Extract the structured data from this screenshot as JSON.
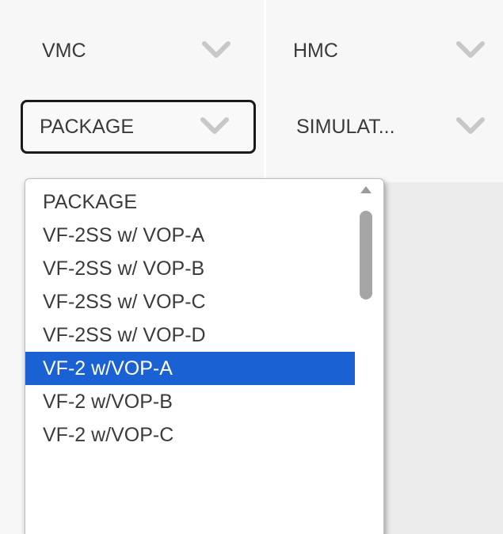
{
  "filters": {
    "vmc": {
      "label": "VMC",
      "icon": "chevron-down-icon"
    },
    "hmc": {
      "label": "HMC",
      "icon": "chevron-down-icon"
    },
    "package": {
      "label": "PACKAGE",
      "icon": "chevron-down-icon"
    },
    "simulator": {
      "label": "SIMULAT...",
      "icon": "chevron-down-icon"
    }
  },
  "package_dropdown": {
    "options": [
      "PACKAGE",
      "VF-2SS w/ VOP-A",
      "VF-2SS w/ VOP-B",
      "VF-2SS w/ VOP-C",
      "VF-2SS w/ VOP-D",
      "VF-2 w/VOP-A",
      "VF-2 w/VOP-B",
      "VF-2 w/VOP-C"
    ],
    "highlighted": "VF-2 w/VOP-A"
  },
  "colors": {
    "highlight": "#1a62d4",
    "chevron": "#c8c8c8",
    "panel": "#f7f7f7"
  }
}
